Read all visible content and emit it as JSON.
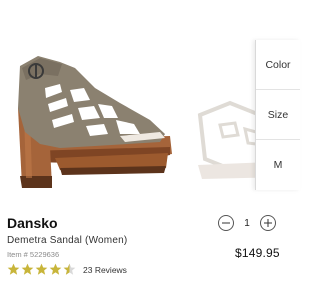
{
  "product": {
    "brand": "Dansko",
    "name": "Demetra Sandal (Women)",
    "item_number": "Item # 5229636",
    "rating": 4.5,
    "reviews_label": "23 Reviews",
    "price": "$149.95"
  },
  "options": {
    "color_label": "Color",
    "size_label": "Size",
    "size_value": "M"
  },
  "quantity": {
    "value": "1",
    "decrement_icon": "minus-icon",
    "increment_icon": "plus-icon"
  },
  "colors": {
    "star": "#c8b53a",
    "star_empty": "#d9d9d9",
    "sandal_upper": "#8b8170",
    "sandal_wood": "#9c5a2e"
  }
}
